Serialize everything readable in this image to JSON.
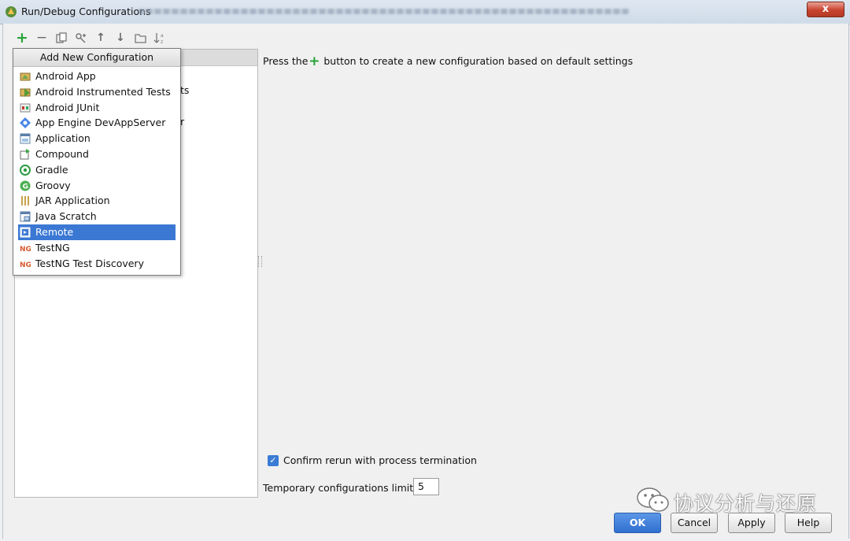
{
  "window": {
    "title": "Run/Debug Configurations",
    "close_label": "x"
  },
  "toolbar": [
    {
      "name": "add-icon",
      "glyph": "+"
    },
    {
      "name": "remove-icon",
      "glyph": "−"
    },
    {
      "name": "copy-icon",
      "glyph": "⎘"
    },
    {
      "name": "edit-defaults-icon",
      "glyph": "⚙"
    },
    {
      "name": "move-up-icon",
      "glyph": "↑"
    },
    {
      "name": "move-down-icon",
      "glyph": "↓"
    },
    {
      "name": "folder-icon",
      "glyph": "▭"
    },
    {
      "name": "sort-icon",
      "glyph": "⇅"
    }
  ],
  "tree_fragments": {
    "frag1": "ts",
    "frag2": "r"
  },
  "popup": {
    "title": "Add New Configuration",
    "items": [
      {
        "label": "Android App",
        "icon": "android-app-icon",
        "selected": false
      },
      {
        "label": "Android Instrumented Tests",
        "icon": "android-tests-icon",
        "selected": false
      },
      {
        "label": "Android JUnit",
        "icon": "android-junit-icon",
        "selected": false
      },
      {
        "label": "App Engine DevAppServer",
        "icon": "app-engine-icon",
        "selected": false
      },
      {
        "label": "Application",
        "icon": "application-icon",
        "selected": false
      },
      {
        "label": "Compound",
        "icon": "compound-icon",
        "selected": false
      },
      {
        "label": "Gradle",
        "icon": "gradle-icon",
        "selected": false
      },
      {
        "label": "Groovy",
        "icon": "groovy-icon",
        "selected": false
      },
      {
        "label": "JAR Application",
        "icon": "jar-icon",
        "selected": false
      },
      {
        "label": "Java Scratch",
        "icon": "java-scratch-icon",
        "selected": false
      },
      {
        "label": "Remote",
        "icon": "remote-icon",
        "selected": true
      },
      {
        "label": "TestNG",
        "icon": "testng-icon",
        "selected": false
      },
      {
        "label": "TestNG Test Discovery",
        "icon": "testng-discovery-icon",
        "selected": false
      }
    ]
  },
  "main": {
    "hint_before": "Press the",
    "hint_after": " button to create a new configuration based on default settings",
    "confirm_rerun_label": "Confirm rerun with process termination",
    "confirm_rerun_checked": true,
    "limit_label": "Temporary configurations limit:",
    "limit_value": "5"
  },
  "buttons": {
    "ok": "OK",
    "cancel": "Cancel",
    "apply": "Apply",
    "help": "Help"
  },
  "watermark": {
    "text": "协议分析与还原"
  },
  "colors": {
    "selection": "#3b78d4",
    "ok_button": "#2f6fd0",
    "add_green": "#2aa33a"
  }
}
